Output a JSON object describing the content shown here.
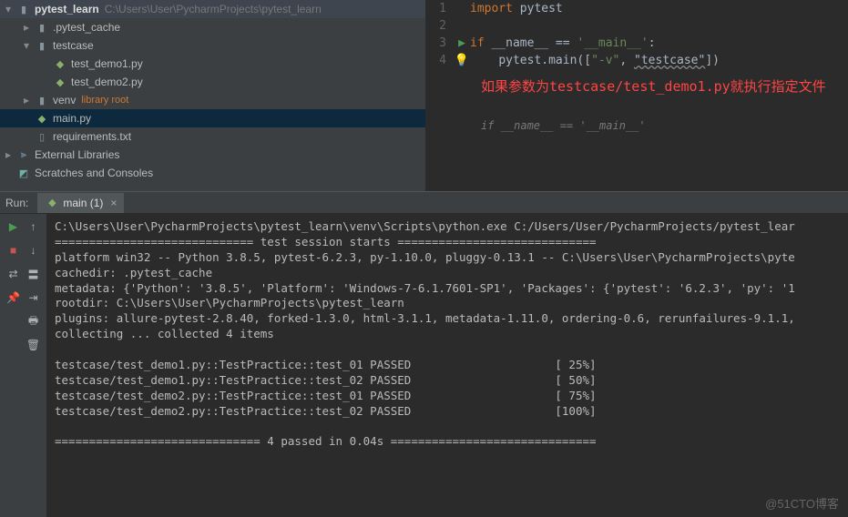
{
  "tree": {
    "root": {
      "name": "pytest_learn",
      "path": "C:\\Users\\User\\PycharmProjects\\pytest_learn"
    },
    "pytest_cache": ".pytest_cache",
    "testcase": "testcase",
    "demo1": "test_demo1.py",
    "demo2": "test_demo2.py",
    "venv": "venv",
    "venv_tag": "library root",
    "main": "main.py",
    "req": "requirements.txt",
    "ext": "External Libraries",
    "scratch": "Scratches and Consoles"
  },
  "editor": {
    "l1": "import pytest",
    "l3a": "if ",
    "l3b": "__name__",
    "l3c": " == ",
    "l3d": "'__main__'",
    "l3e": ":",
    "l4a": "pytest.main([",
    "l4b": "\"-v\"",
    "l4c": ", ",
    "l4d": "\"testcase\"",
    "l4e": "])",
    "annot": "如果参数为testcase/test_demo1.py就执行指定文件",
    "hint": "if __name__ == '__main__'"
  },
  "run": {
    "label": "Run:",
    "tab": "main (1)",
    "lines": [
      "C:\\Users\\User\\PycharmProjects\\pytest_learn\\venv\\Scripts\\python.exe C:/Users/User/PycharmProjects/pytest_lear",
      "============================= test session starts =============================",
      "platform win32 -- Python 3.8.5, pytest-6.2.3, py-1.10.0, pluggy-0.13.1 -- C:\\Users\\User\\PycharmProjects\\pyte",
      "cachedir: .pytest_cache",
      "metadata: {'Python': '3.8.5', 'Platform': 'Windows-7-6.1.7601-SP1', 'Packages': {'pytest': '6.2.3', 'py': '1",
      "rootdir: C:\\Users\\User\\PycharmProjects\\pytest_learn",
      "plugins: allure-pytest-2.8.40, forked-1.3.0, html-3.1.1, metadata-1.11.0, ordering-0.6, rerunfailures-9.1.1,",
      "collecting ... collected 4 items",
      "",
      "testcase/test_demo1.py::TestPractice::test_01 PASSED                     [ 25%]",
      "testcase/test_demo1.py::TestPractice::test_02 PASSED                     [ 50%]",
      "testcase/test_demo2.py::TestPractice::test_01 PASSED                     [ 75%]",
      "testcase/test_demo2.py::TestPractice::test_02 PASSED                     [100%]",
      "",
      "============================== 4 passed in 0.04s =============================="
    ]
  },
  "watermark": "@51CTO博客"
}
